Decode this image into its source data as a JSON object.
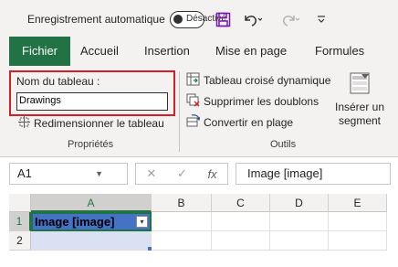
{
  "titlebar": {
    "autosave_label": "Enregistrement automatique",
    "autosave_state": "Désactivé",
    "icons": [
      "save-icon",
      "undo-icon",
      "redo-icon",
      "customize-toolbar-icon"
    ]
  },
  "tabs": [
    {
      "label": "Fichier",
      "active": true
    },
    {
      "label": "Accueil"
    },
    {
      "label": "Insertion"
    },
    {
      "label": "Mise en page"
    },
    {
      "label": "Formules"
    }
  ],
  "ribbon": {
    "properties": {
      "table_name_label": "Nom du tableau :",
      "table_name_value": "Drawings",
      "resize_label": "Redimensionner le tableau",
      "group_label": "Propriétés"
    },
    "tools": {
      "pivot_label": "Tableau croisé dynamique",
      "remove_duplicates_label": "Supprimer les doublons",
      "convert_label": "Convertir en plage",
      "group_label": "Outils"
    },
    "slicer": {
      "line1": "Insérer un",
      "line2": "segment"
    }
  },
  "formula_bar": {
    "name_box": "A1",
    "cancel_symbol": "✕",
    "enter_symbol": "✓",
    "fx_symbol": "fx",
    "content": "Image [image]"
  },
  "grid": {
    "columns": [
      "A",
      "B",
      "C",
      "D",
      "E"
    ],
    "rows": [
      "1",
      "2"
    ],
    "cell_a1": "Image [image]",
    "filter_glyph": "▾"
  },
  "colors": {
    "accent": "#217346",
    "highlight_box": "#d32026",
    "table_header": "#4472c4",
    "table_row": "#d9e1f2"
  }
}
